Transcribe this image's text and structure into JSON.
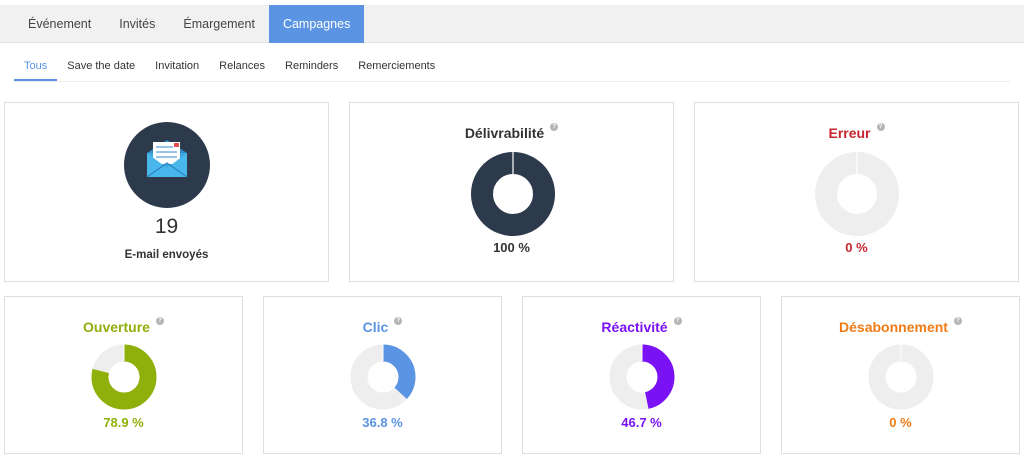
{
  "tabs": [
    {
      "label": "Événement"
    },
    {
      "label": "Invités"
    },
    {
      "label": "Émargement"
    },
    {
      "label": "Campagnes",
      "active": true
    }
  ],
  "subtabs": [
    {
      "label": "Tous",
      "active": true
    },
    {
      "label": "Save the date"
    },
    {
      "label": "Invitation"
    },
    {
      "label": "Relances"
    },
    {
      "label": "Reminders"
    },
    {
      "label": "Remerciements"
    }
  ],
  "sent": {
    "count": "19",
    "label": "E-mail envoyés",
    "icon": "email-envelope-icon"
  },
  "help_icon": "?",
  "colors": {
    "track": "#eeeeee",
    "active_tab": "#5b94e3"
  },
  "stats": [
    {
      "key": "delivrabilite",
      "title": "Délivrabilité",
      "value": 100,
      "pct_label": "100 %",
      "color": "#2d3a4b",
      "title_color": "#333333",
      "pct_color": "#333333"
    },
    {
      "key": "erreur",
      "title": "Erreur",
      "value": 0,
      "pct_label": "0 %",
      "color": "#c8242e",
      "title_color": "#c8242e",
      "pct_color": "#c8242e"
    },
    {
      "key": "ouverture",
      "title": "Ouverture",
      "value": 78.9,
      "pct_label": "78.9 %",
      "color": "#8fb00b",
      "title_color": "#8fb00b",
      "pct_color": "#8fb00b"
    },
    {
      "key": "clic",
      "title": "Clic",
      "value": 36.8,
      "pct_label": "36.8 %",
      "color": "#5b94e3",
      "title_color": "#5b94e3",
      "pct_color": "#5b94e3"
    },
    {
      "key": "reactivite",
      "title": "Réactivité",
      "value": 46.7,
      "pct_label": "46.7 %",
      "color": "#7b11f5",
      "title_color": "#7b11f5",
      "pct_color": "#7b11f5"
    },
    {
      "key": "desabonnement",
      "title": "Désabonnement",
      "value": 0,
      "pct_label": "0 %",
      "color": "#f07b15",
      "title_color": "#f07b15",
      "pct_color": "#f07b15"
    }
  ]
}
